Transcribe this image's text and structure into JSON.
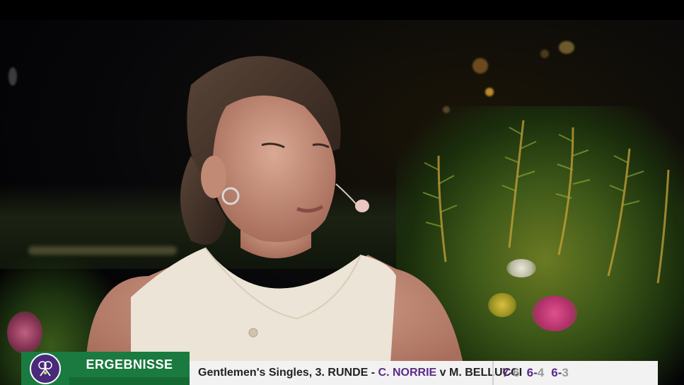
{
  "broadcast": {
    "section_label": "ERGEBNISSE",
    "logo_text": "THE CHAMPIONSHIPS WIMBLEDON"
  },
  "match": {
    "event_round": "Gentlemen's Singles, 3. RUNDE -",
    "player1": "C. NORRIE",
    "versus": "v",
    "player2": "M. BELLUCCI"
  },
  "scores": [
    {
      "p1": "7",
      "sep": "-",
      "p2": "6"
    },
    {
      "p1": "6",
      "sep": "-",
      "p2": "4"
    },
    {
      "p1": "6",
      "sep": "-",
      "p2": "3"
    }
  ],
  "colors": {
    "wimbledon_green": "#1a7a3f",
    "wimbledon_purple": "#5b2a86",
    "bar_background": "#f2f2f2"
  }
}
